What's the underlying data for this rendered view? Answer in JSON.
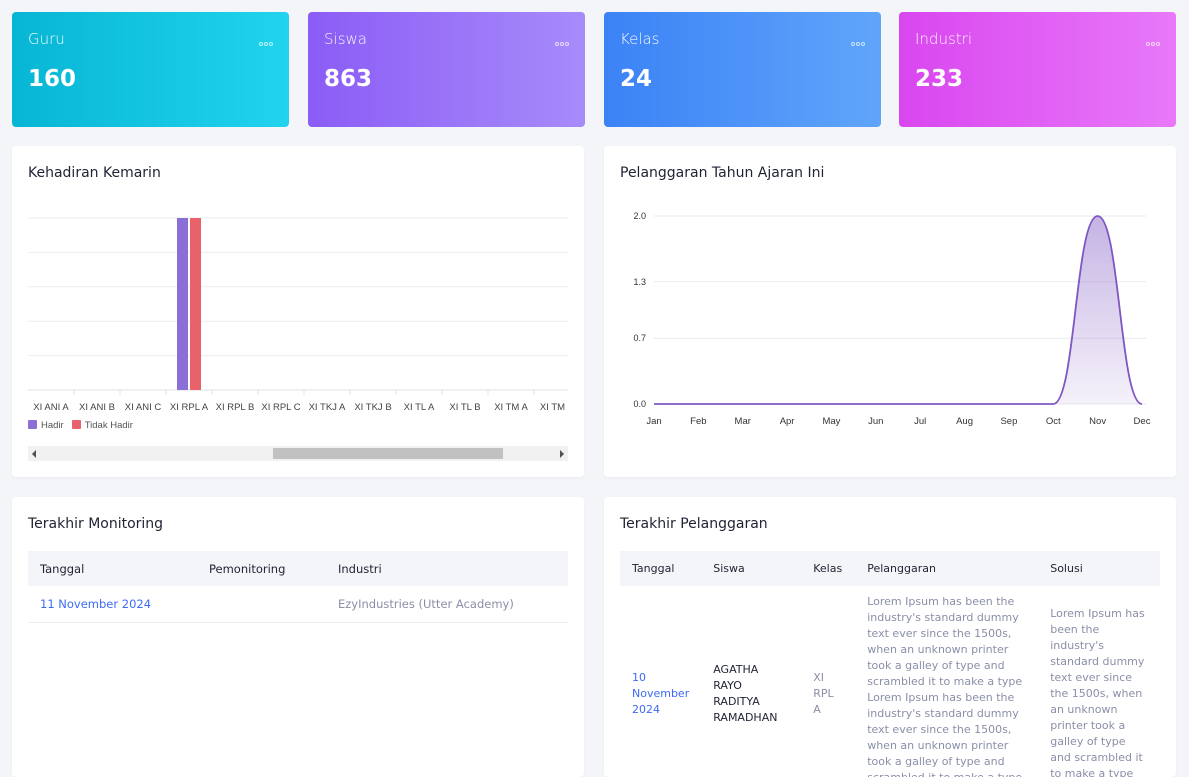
{
  "stats": [
    {
      "label": "Guru",
      "value": "160",
      "gradient": [
        "#06b6d4",
        "#22d3ee"
      ]
    },
    {
      "label": "Siswa",
      "value": "863",
      "gradient": [
        "#8b5cf6",
        "#a78bfa"
      ]
    },
    {
      "label": "Kelas",
      "value": "24",
      "gradient": [
        "#3b82f6",
        "#60a5fa"
      ]
    },
    {
      "label": "Industri",
      "value": "233",
      "gradient": [
        "#d946ef",
        "#e879f9"
      ]
    }
  ],
  "attendance": {
    "title": "Kehadiran Kemarin",
    "chart_data": {
      "type": "bar",
      "categories": [
        "XI ANI A",
        "XI ANI B",
        "XI ANI C",
        "XI RPL A",
        "XI RPL B",
        "XI RPL C",
        "XI TKJ A",
        "XI TKJ B",
        "XI TL A",
        "XI TL B",
        "XI TM A",
        "XI TM B"
      ],
      "series": [
        {
          "name": "Hadir",
          "color": "#8b6fd6",
          "values": [
            0,
            0,
            0,
            1,
            0,
            0,
            0,
            0,
            0,
            0,
            0,
            0
          ]
        },
        {
          "name": "Tidak Hadir",
          "color": "#e8616b",
          "values": [
            0,
            0,
            0,
            1,
            0,
            0,
            0,
            0,
            0,
            0,
            0,
            0
          ]
        }
      ],
      "ylim": [
        0,
        1
      ],
      "legend": "bottom-left"
    }
  },
  "violations_chart": {
    "title": "Pelanggaran Tahun Ajaran Ini",
    "chart_data": {
      "type": "area",
      "x": [
        "Jan",
        "Feb",
        "Mar",
        "Apr",
        "May",
        "Jun",
        "Jul",
        "Aug",
        "Sep",
        "Oct",
        "Nov",
        "Dec"
      ],
      "values": [
        0,
        0,
        0,
        0,
        0,
        0,
        0,
        0,
        0,
        0,
        2,
        0
      ],
      "yticks": [
        "0.0",
        "0.7",
        "1.3",
        "2.0"
      ],
      "ylim": [
        0,
        2
      ],
      "color": "#7e57c2"
    }
  },
  "monitoring": {
    "title": "Terakhir Monitoring",
    "columns": [
      "Tanggal",
      "Pemonitoring",
      "Industri"
    ],
    "rows": [
      [
        "11 November 2024",
        "",
        "EzyIndustries (Utter Academy)"
      ]
    ]
  },
  "violations": {
    "title": "Terakhir Pelanggaran",
    "columns": [
      "Tanggal",
      "Siswa",
      "Kelas",
      "Pelanggaran",
      "Solusi"
    ],
    "rows": [
      [
        "10 November 2024",
        "AGATHA RAYO RADITYA RAMADHAN",
        "XI RPL A",
        "Lorem Ipsum has been the industry's standard dummy text ever since the 1500s, when an unknown printer took a galley of type and scrambled it to make a type Lorem Ipsum has been the industry's standard dummy text ever since the 1500s, when an unknown printer took a galley of type and scrambled it to make a type",
        "Lorem Ipsum has been the industry's standard dummy text ever since the 1500s, when an unknown printer took a galley of type and scrambled it to make a type"
      ]
    ]
  }
}
